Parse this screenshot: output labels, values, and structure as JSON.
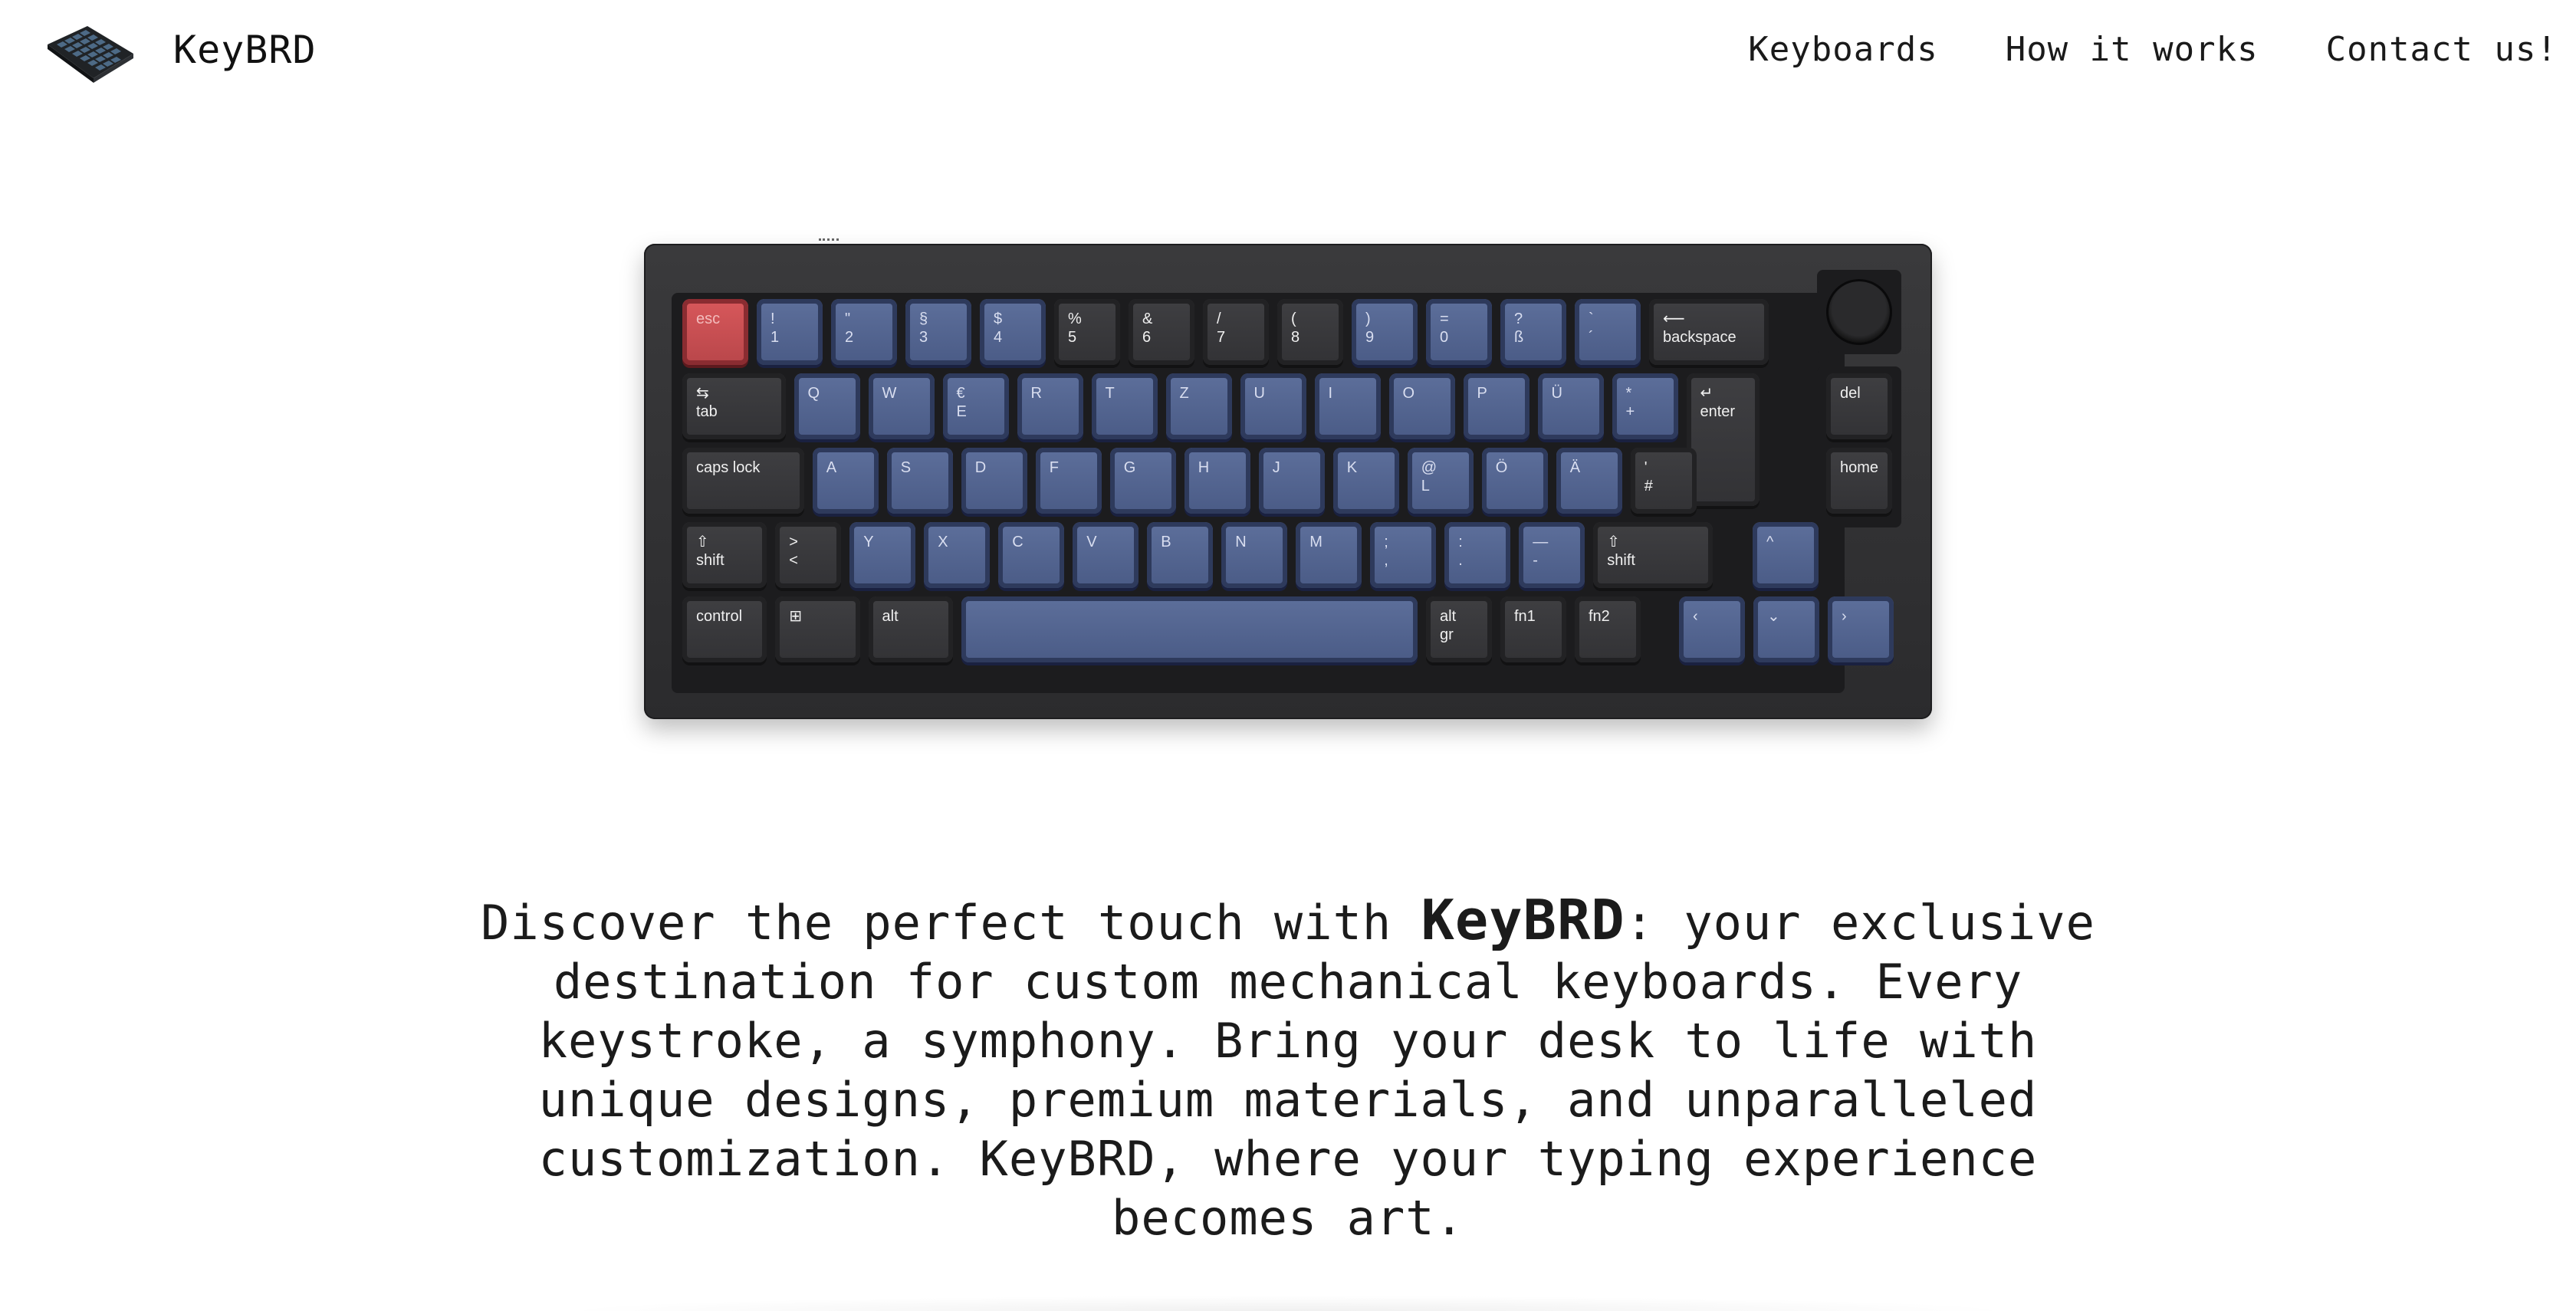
{
  "header": {
    "brand": "KeyBRD",
    "nav": [
      "Keyboards",
      "How it works",
      "Contact us!"
    ]
  },
  "hero": {
    "image_alt": "mechanical keyboard",
    "keyboard": {
      "row1": [
        "esc",
        "!\n1",
        "\"\n2",
        "§\n3",
        "$\n4",
        "%\n5",
        "&\n6",
        "/\n7",
        "(\n8",
        ")\n9",
        "=\n0",
        "?\nß",
        "`\n´",
        "⟵\nbackspace"
      ],
      "row2": [
        "⇆\ntab",
        "Q",
        "W",
        "€\nE",
        "R",
        "T",
        "Z",
        "U",
        "I",
        "O",
        "P",
        "Ü",
        "*\n+",
        "↵\nenter",
        "del"
      ],
      "row3": [
        "caps lock",
        "A",
        "S",
        "D",
        "F",
        "G",
        "H",
        "J",
        "K",
        "@\nL",
        "Ö",
        "Ä",
        "'\n#",
        "home"
      ],
      "row4": [
        "⇧\nshift",
        ">\n<",
        "Y",
        "X",
        "C",
        "V",
        "B",
        "N",
        "M",
        ";\n,",
        ":\n.",
        "—\n-",
        "⇧\nshift",
        "^"
      ],
      "row5": [
        "control",
        "⊞",
        "alt",
        "",
        "alt\ngr",
        "fn1",
        "fn2",
        "‹",
        "⌄",
        "›"
      ]
    }
  },
  "intro": {
    "before": "Discover the perfect touch with ",
    "brand": "KeyBRD",
    "after": ": your exclusive destination for custom mechanical keyboards. Every keystroke, a symphony. Bring your desk to life with unique designs, premium materials, and unparalleled customization. KeyBRD, where your typing experience becomes art."
  },
  "colors": {
    "accent_blue": "#4a5b86",
    "key_dark": "#323235",
    "esc_red": "#c84e52",
    "logo_blue": "#4d6a86"
  }
}
